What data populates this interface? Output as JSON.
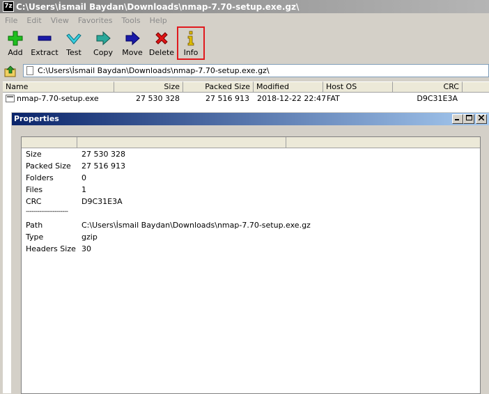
{
  "window": {
    "app_icon": "7z",
    "title": "C:\\Users\\İsmail Baydan\\Downloads\\nmap-7.70-setup.exe.gz\\"
  },
  "menu": [
    "File",
    "Edit",
    "View",
    "Favorites",
    "Tools",
    "Help"
  ],
  "toolbar": {
    "add": "Add",
    "extract": "Extract",
    "test": "Test",
    "copy": "Copy",
    "move": "Move",
    "delete": "Delete",
    "info": "Info",
    "info_highlight_color": "#e0191e"
  },
  "address": {
    "path": "C:\\Users\\İsmail Baydan\\Downloads\\nmap-7.70-setup.exe.gz\\"
  },
  "file_list": {
    "columns": [
      "Name",
      "Size",
      "Packed Size",
      "Modified",
      "Host OS",
      "CRC"
    ],
    "rows": [
      {
        "name": "nmap-7.70-setup.exe",
        "size": "27 530 328",
        "packed_size": "27 516 913",
        "modified": "2018-12-22 22:47",
        "host_os": "FAT",
        "crc": "D9C31E3A"
      }
    ]
  },
  "properties": {
    "title": "Properties",
    "rows": [
      {
        "key": "Size",
        "value": "27 530 328"
      },
      {
        "key": "Packed Size",
        "value": "27 516 913"
      },
      {
        "key": "Folders",
        "value": "0"
      },
      {
        "key": "Files",
        "value": "1"
      },
      {
        "key": "CRC",
        "value": "D9C31E3A"
      },
      {
        "key": "----------------------",
        "value": ""
      },
      {
        "key": "Path",
        "value": "C:\\Users\\İsmail Baydan\\Downloads\\nmap-7.70-setup.exe.gz"
      },
      {
        "key": "Type",
        "value": "gzip"
      },
      {
        "key": "Headers Size",
        "value": "30"
      }
    ]
  }
}
